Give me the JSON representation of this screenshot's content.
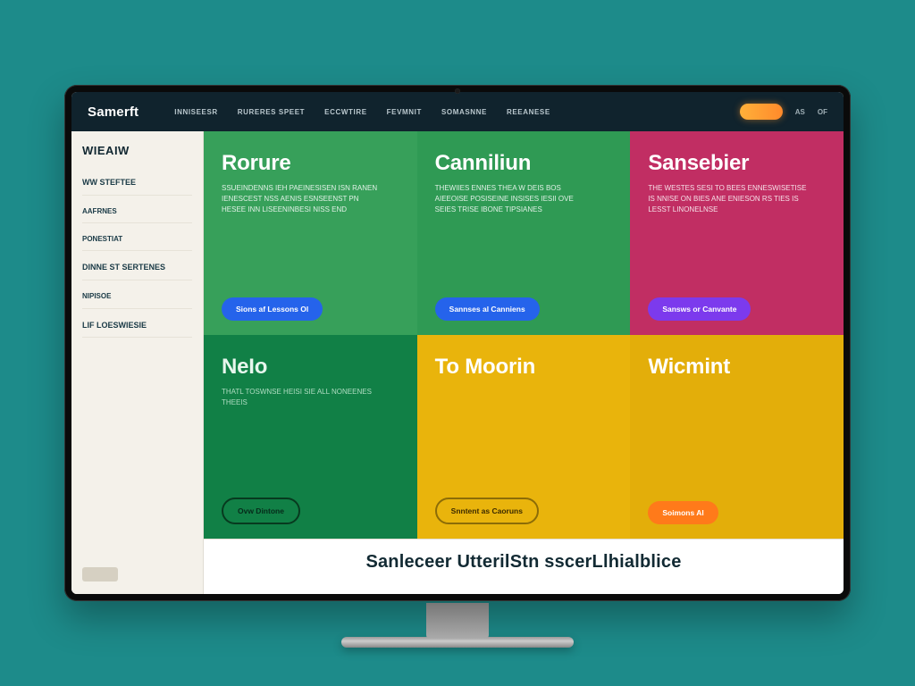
{
  "brand": "Samerft",
  "nav": {
    "items": [
      "INNISEESR",
      "RURERES SPEET",
      "ECCWTIRE",
      "FEVMNIT",
      "SOMASNNE",
      "REEANESE"
    ],
    "extra1": "AS",
    "extra2": "OF"
  },
  "sidebar": {
    "title": "WIEAIW",
    "items": [
      "WW STEFTEE",
      "AAFRNES",
      "PONESTIAT",
      "DINNE ST SERTENES",
      "NIPISOE",
      "LIF LOESWIESIE"
    ]
  },
  "tiles": [
    {
      "slug": "rorure",
      "title": "Rorure",
      "desc": "SSUEINDENNS IEH PAEINESISEN ISN RANEN IENESCEST NSS AENIS ESNSEENST PN HESEE INN LISEENINBESI NISS END",
      "button": "Sions af Lessons Ol"
    },
    {
      "slug": "canniliun",
      "title": "Canniliun",
      "desc": "THEWIIES ENNES THEA W DEIS BOS AIEEOISE POSISEINE INSISES IESII OVE SEIES TRISE IBONE TIPSIANES",
      "button": "Sannses al Canniens"
    },
    {
      "slug": "sansebier",
      "title": "Sansebier",
      "desc": "THE WESTES SESI TO BEES ENNESWISETISE IS NNISE ON BIES ANE ENIESON RS TIES IS LESST LINONELNSE",
      "button": "Sansws or Canvante"
    },
    {
      "slug": "nelo",
      "title": "NeIo",
      "desc": "THATL TOSWNSE HEISI SIE ALL NONEENES THEEIS",
      "button": "Ovw Dintone"
    },
    {
      "slug": "tomoorin",
      "title": "To Moorin",
      "desc": "",
      "button": "Snntent as Caoruns"
    },
    {
      "slug": "wicmint",
      "title": "Wicmint",
      "desc": "",
      "button": "Soimons Al"
    }
  ],
  "footer": {
    "tagline": "Sanleceer UtterilStn sscerLlhialblice"
  }
}
